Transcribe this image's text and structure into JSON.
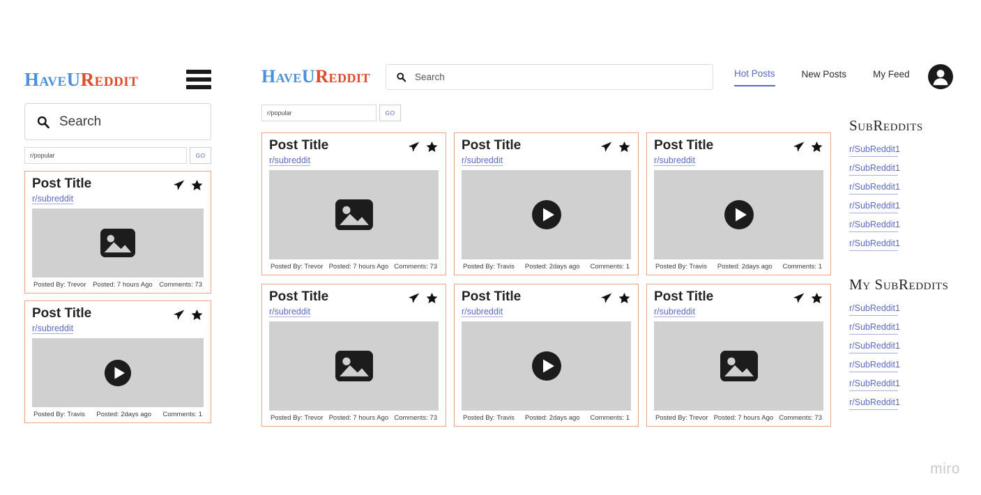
{
  "brand": {
    "logo_part_a": "HaveU",
    "logo_part_b": "Reddit",
    "color_a": "#4a90d9",
    "color_b": "#e04b2e",
    "accent_link": "#5b6ac4",
    "card_border": "#eda289",
    "media_bg": "#d0d0d0"
  },
  "mobile": {
    "search_placeholder": "Search",
    "subreddit_value": "r/popular",
    "go_label": "GO",
    "menu_icon": "hamburger-icon",
    "search_icon": "search-icon",
    "cards": [
      {
        "title": "Post Title",
        "subreddit": "r/subreddit",
        "media_type": "image",
        "posted_by": "Posted By: Trevor",
        "posted_when": "Posted: 7 hours Ago",
        "comments": "Comments: 73",
        "share_icon": "share-paper-plane-icon",
        "star_icon": "star-icon"
      },
      {
        "title": "Post Title",
        "subreddit": "r/subreddit",
        "media_type": "video",
        "posted_by": "Posted By: Travis",
        "posted_when": "Posted: 2days ago",
        "comments": "Comments: 1",
        "share_icon": "share-paper-plane-icon",
        "star_icon": "star-icon"
      }
    ]
  },
  "main": {
    "search_placeholder": "Search",
    "search_icon": "search-icon",
    "subreddit_value": "r/popular",
    "go_label": "GO",
    "avatar_icon": "user-avatar-icon",
    "nav": [
      {
        "label": "Hot Posts",
        "active": true
      },
      {
        "label": "New Posts",
        "active": false
      },
      {
        "label": "My Feed",
        "active": false
      }
    ],
    "cards": [
      {
        "title": "Post Title",
        "subreddit": "r/subreddit",
        "media_type": "image",
        "posted_by": "Posted By: Trevor",
        "posted_when": "Posted: 7 hours Ago",
        "comments": "Comments: 73"
      },
      {
        "title": "Post Title",
        "subreddit": "r/subreddit",
        "media_type": "video",
        "posted_by": "Posted By: Travis",
        "posted_when": "Posted: 2days ago",
        "comments": "Comments: 1"
      },
      {
        "title": "Post Title",
        "subreddit": "r/subreddit",
        "media_type": "video",
        "posted_by": "Posted By: Travis",
        "posted_when": "Posted: 2days ago",
        "comments": "Comments: 1"
      },
      {
        "title": "Post Title",
        "subreddit": "r/subreddit",
        "media_type": "image",
        "posted_by": "Posted By: Trevor",
        "posted_when": "Posted: 7 hours Ago",
        "comments": "Comments: 73"
      },
      {
        "title": "Post Title",
        "subreddit": "r/subreddit",
        "media_type": "video",
        "posted_by": "Posted By: Travis",
        "posted_when": "Posted: 2days ago",
        "comments": "Comments: 1"
      },
      {
        "title": "Post Title",
        "subreddit": "r/subreddit",
        "media_type": "image",
        "posted_by": "Posted By: Trevor",
        "posted_when": "Posted: 7 hours Ago",
        "comments": "Comments: 73"
      }
    ]
  },
  "sidebar": {
    "subreddits_heading": "SubReddits",
    "my_subreddits_heading": "My SubReddits",
    "subreddits": [
      "r/SubReddit1",
      "r/SubReddit1",
      "r/SubReddit1",
      "r/SubReddit1",
      "r/SubReddit1",
      "r/SubReddit1"
    ],
    "my_subreddits": [
      "r/SubReddit1",
      "r/SubReddit1",
      "r/SubReddit1",
      "r/SubReddit1",
      "r/SubReddit1",
      "r/SubReddit1"
    ]
  },
  "watermark": "miro"
}
